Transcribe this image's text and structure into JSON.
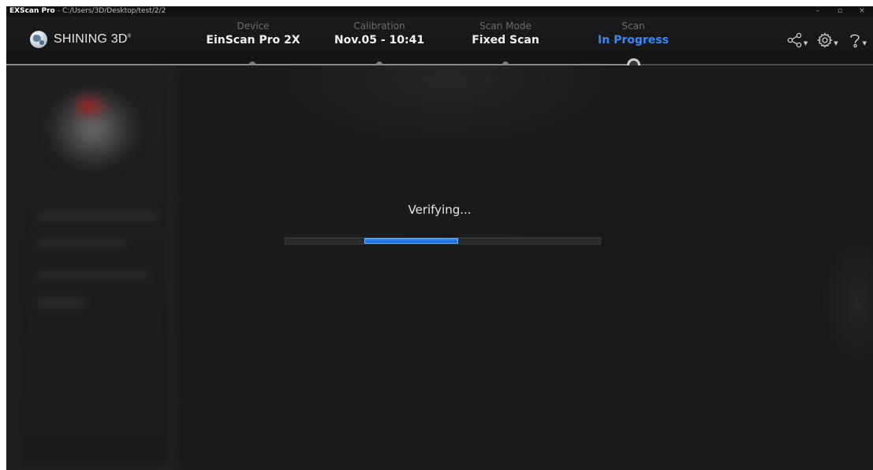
{
  "window": {
    "app_name": "EXScan Pro",
    "separator": "-",
    "path": "C:/Users/3D/Desktop/test/2/2",
    "controls": {
      "minimize": "–",
      "restore": "▫",
      "close": "×"
    }
  },
  "header": {
    "logo_text": "SHINING 3D",
    "logo_mark": "®",
    "steps": [
      {
        "label": "Device",
        "value": "EinScan Pro 2X"
      },
      {
        "label": "Calibration",
        "value": "Nov.05 - 10:41"
      },
      {
        "label": "Scan Mode",
        "value": "Fixed Scan"
      },
      {
        "label": "Scan",
        "value": "In Progress"
      }
    ],
    "active_step": 3,
    "tools": [
      "share-icon",
      "settings-icon",
      "help-icon"
    ],
    "accent_color": "#2f8cff"
  },
  "main": {
    "status": "Verifying...",
    "progress": {
      "indeterminate": true,
      "segment_start": 0.25,
      "segment_end": 0.55
    }
  }
}
